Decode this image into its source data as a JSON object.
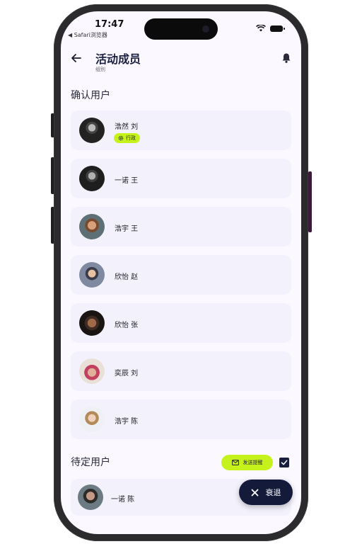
{
  "status_bar": {
    "time": "17:47",
    "back_app": "◀ Safari浏览器"
  },
  "header": {
    "title": "活动成员",
    "subtitle": "组别"
  },
  "confirmed": {
    "title": "确认用户",
    "users": [
      {
        "name": "浩然 刘",
        "role": "行政"
      },
      {
        "name": "一诺 王"
      },
      {
        "name": "浩宇 王"
      },
      {
        "name": "欣怡 赵"
      },
      {
        "name": "欣怡 张"
      },
      {
        "name": "奕辰 刘"
      },
      {
        "name": "浩宇 陈"
      }
    ]
  },
  "pending": {
    "title": "待定用户",
    "remind_label": "发送提醒",
    "users": [
      {
        "name": "一诺 陈"
      }
    ]
  },
  "fab": {
    "label": "衰退"
  },
  "colors": {
    "accent": "#c6f21c",
    "navy": "#131a3a",
    "card": "#f3f1fb",
    "background": "#fbf9ff"
  },
  "icons": {
    "back": "arrow-left-icon",
    "bell": "bell-icon",
    "mail": "mail-icon",
    "close": "close-icon",
    "check": "check-icon",
    "gear": "gear-icon"
  }
}
